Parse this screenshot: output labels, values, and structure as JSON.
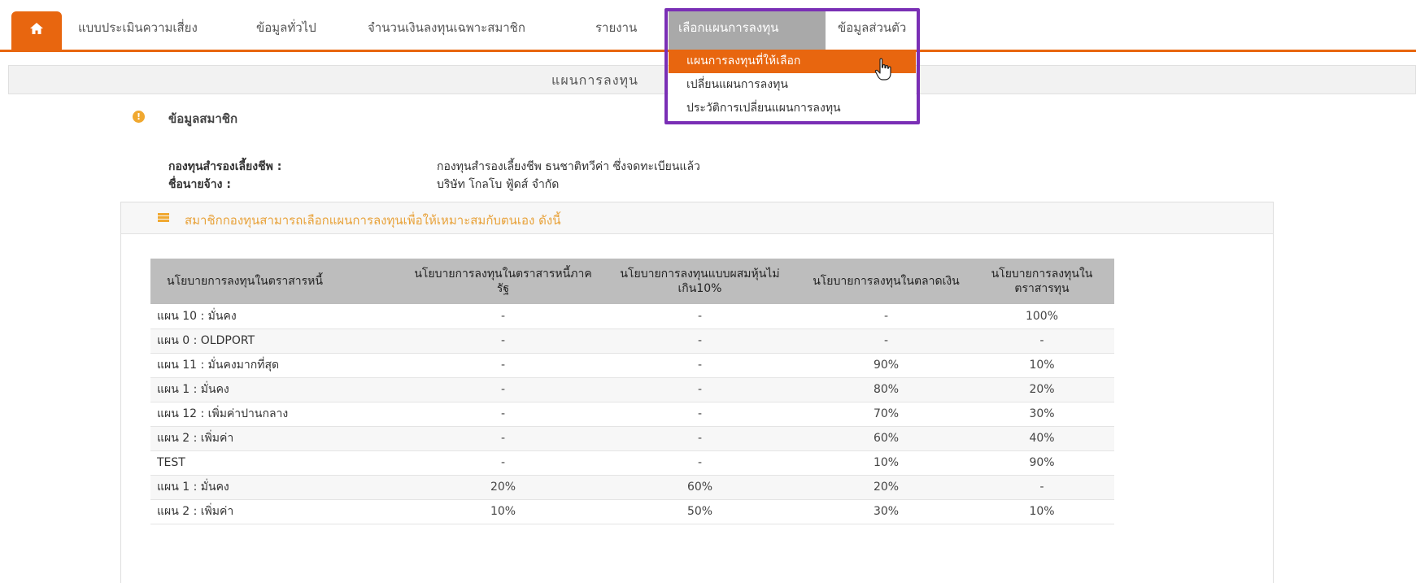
{
  "nav": {
    "items": [
      {
        "label": "แบบประเมินความเสี่ยง"
      },
      {
        "label": "ข้อมูลทั่วไป"
      },
      {
        "label": "จำนวนเงินลงทุนเฉพาะสมาชิก"
      },
      {
        "label": "รายงาน"
      },
      {
        "label": "เลือกแผนการลงทุน"
      },
      {
        "label": "ข้อมูลส่วนตัว"
      }
    ],
    "active_index": 4
  },
  "dropdown": {
    "items": [
      {
        "label": "แผนการลงทุนที่ให้เลือก"
      },
      {
        "label": "เปลี่ยนแผนการลงทุน"
      },
      {
        "label": "ประวัติการเปลี่ยนแผนการลงทุน"
      }
    ],
    "highlighted_index": 0
  },
  "page": {
    "title": "แผนการลงทุน"
  },
  "member": {
    "section_title": "ข้อมูลสมาชิก",
    "fund_label": "กองทุนสำรองเลี้ยงชีพ :",
    "fund_value": "กองทุนสำรองเลี้ยงชีพ ธนชาติทวีค่า ซึ่งจดทะเบียนแล้ว",
    "employer_label": "ชื่อนายจ้าง :",
    "employer_value": "บริษัท โกลโบ ฟู้ดส์ จำกัด"
  },
  "panel": {
    "title": "สมาชิกกองทุนสามารถเลือกแผนการลงทุนเพื่อให้เหมาะสมกับตนเอง ดังนี้"
  },
  "table": {
    "headers": [
      "นโยบายการลงทุนในตราสารหนี้",
      "นโยบายการลงทุนในตราสารหนี้ภาครัฐ",
      "นโยบายการลงทุนแบบผสมหุ้นไม่เกิน10%",
      "นโยบายการลงทุนในตลาดเงิน",
      "นโยบายการลงทุนในตราสารทุน"
    ],
    "rows": [
      [
        "แผน 10 : มั่นคง",
        "-",
        "-",
        "-",
        "100%"
      ],
      [
        "แผน 0 : OLDPORT",
        "-",
        "-",
        "-",
        "-"
      ],
      [
        "แผน 11 : มั่นคงมากที่สุด",
        "-",
        "-",
        "90%",
        "10%"
      ],
      [
        "แผน 1 : มั่นคง",
        "-",
        "-",
        "80%",
        "20%"
      ],
      [
        "แผน 12 : เพิ่มค่าปานกลาง",
        "-",
        "-",
        "70%",
        "30%"
      ],
      [
        "แผน 2 : เพิ่มค่า",
        "-",
        "-",
        "60%",
        "40%"
      ],
      [
        "TEST",
        "-",
        "-",
        "10%",
        "90%"
      ],
      [
        "แผน 1 : มั่นคง",
        "20%",
        "60%",
        "20%",
        "-"
      ],
      [
        "แผน 2 : เพิ่มค่า",
        "10%",
        "50%",
        "30%",
        "10%"
      ]
    ]
  },
  "colors": {
    "accent": "#e8660f",
    "highlight_box": "#7a2fb5",
    "active_tab": "#a9a9a9",
    "panel_title": "#e8a23a",
    "table_header": "#bdbdbd"
  },
  "icons": {
    "home": "home-icon",
    "info": "info-icon",
    "panel": "list-icon",
    "cursor": "hand-pointer-icon"
  }
}
